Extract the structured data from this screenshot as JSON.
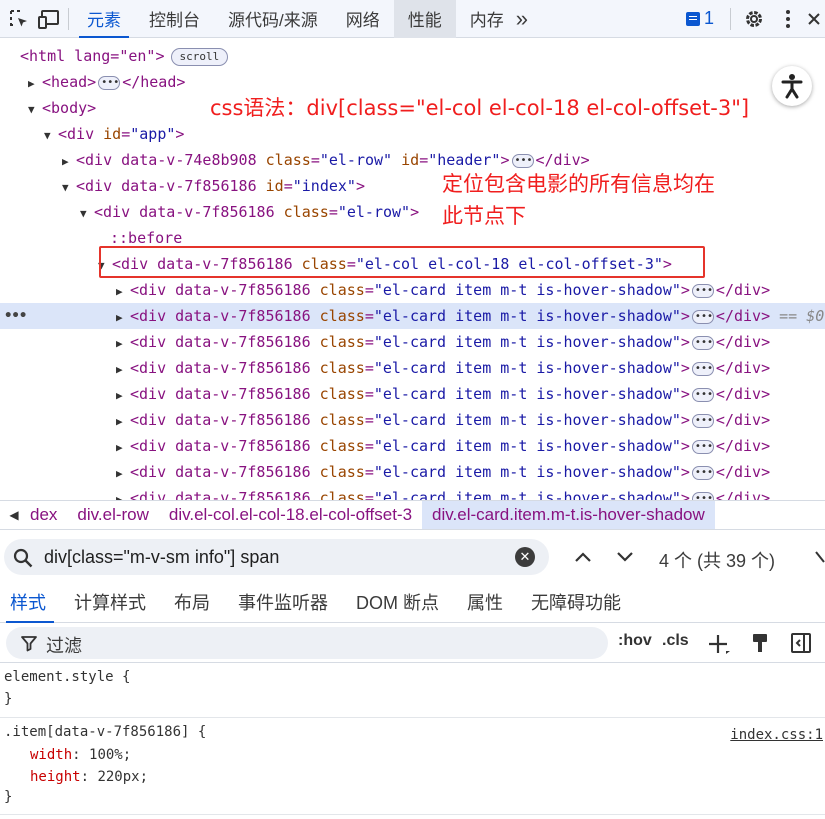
{
  "toolbar": {
    "tabs": [
      "元素",
      "控制台",
      "源代码/来源",
      "网络",
      "性能",
      "内存"
    ],
    "more_tabs": "»",
    "issues_count": "1"
  },
  "dom": {
    "html_open": "<html lang=\"en\">",
    "html_scroll_badge": "scroll",
    "head": "<head>",
    "head_close": "</head>",
    "body": "<body>",
    "app_div": {
      "open": "<div ",
      "attr": "id",
      "val": "\"app\"",
      "close": ">"
    },
    "header_div": {
      "prefix": "<div data-v-74e8b908 ",
      "class_attr": "class",
      "class_val": "\"el-row\"",
      "id_attr": "id",
      "id_val": "\"header\"",
      "suffix": ">",
      "close": "</div>"
    },
    "index_div": {
      "prefix": "<div data-v-7f856186 ",
      "id_attr": "id",
      "id_val": "\"index\"",
      "suffix": ">"
    },
    "row_div": {
      "prefix": "<div data-v-7f856186 ",
      "class_attr": "class",
      "class_val": "\"el-row\"",
      "suffix": ">"
    },
    "before": "::before",
    "col_div": {
      "prefix": "<div data-v-7f856186 ",
      "class_attr": "class",
      "class_val": "\"el-col el-col-18 el-col-offset-3\"",
      "suffix": ">"
    },
    "card_div": {
      "prefix": "<div data-v-7f856186 ",
      "class_attr": "class",
      "class_val": "\"el-card item m-t is-hover-shadow\"",
      "suffix": ">",
      "close": "</div>"
    },
    "selected_suffix": "== $0"
  },
  "annotations": {
    "css_syntax": "css语法：div[class=\"el-col el-col-18 el-col-offset-3\"]",
    "locate_line1": "定位包含电影的所有信息均在",
    "locate_line2": "此节点下"
  },
  "breadcrumbs": [
    "dex",
    "div.el-row",
    "div.el-col.el-col-18.el-col-offset-3",
    "div.el-card.item.m-t.is-hover-shadow"
  ],
  "search": {
    "query": "div[class=\"m-v-sm info\"] span",
    "count": "4 个 (共 39 个)"
  },
  "style_tabs": [
    "样式",
    "计算样式",
    "布局",
    "事件监听器",
    "DOM 断点",
    "属性",
    "无障碍功能"
  ],
  "filter": {
    "placeholder": "过滤",
    "hov": ":hov",
    "cls": ".cls"
  },
  "rules": {
    "element_style": "element.style {",
    "close": "}",
    "item_selector": ".item[data-v-7f856186] {",
    "source": "index.css:1",
    "props": [
      {
        "name": "width",
        "value": "100%;"
      },
      {
        "name": "height",
        "value": "220px;"
      }
    ]
  },
  "colors": {
    "accent": "#0b57d0",
    "annotation_red": "#f01e1e",
    "tag": "#881280",
    "attr": "#994500",
    "value": "#1a1aa6"
  }
}
